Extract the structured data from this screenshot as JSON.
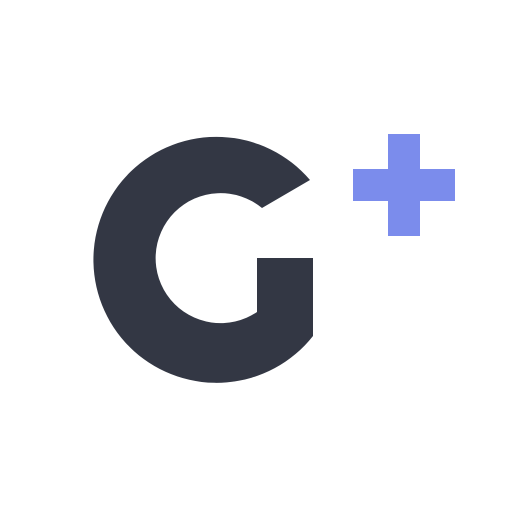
{
  "logo": {
    "name": "G+",
    "colors": {
      "background": "#ffffff",
      "letter": "#333744",
      "plus": "#7b8cec"
    }
  }
}
